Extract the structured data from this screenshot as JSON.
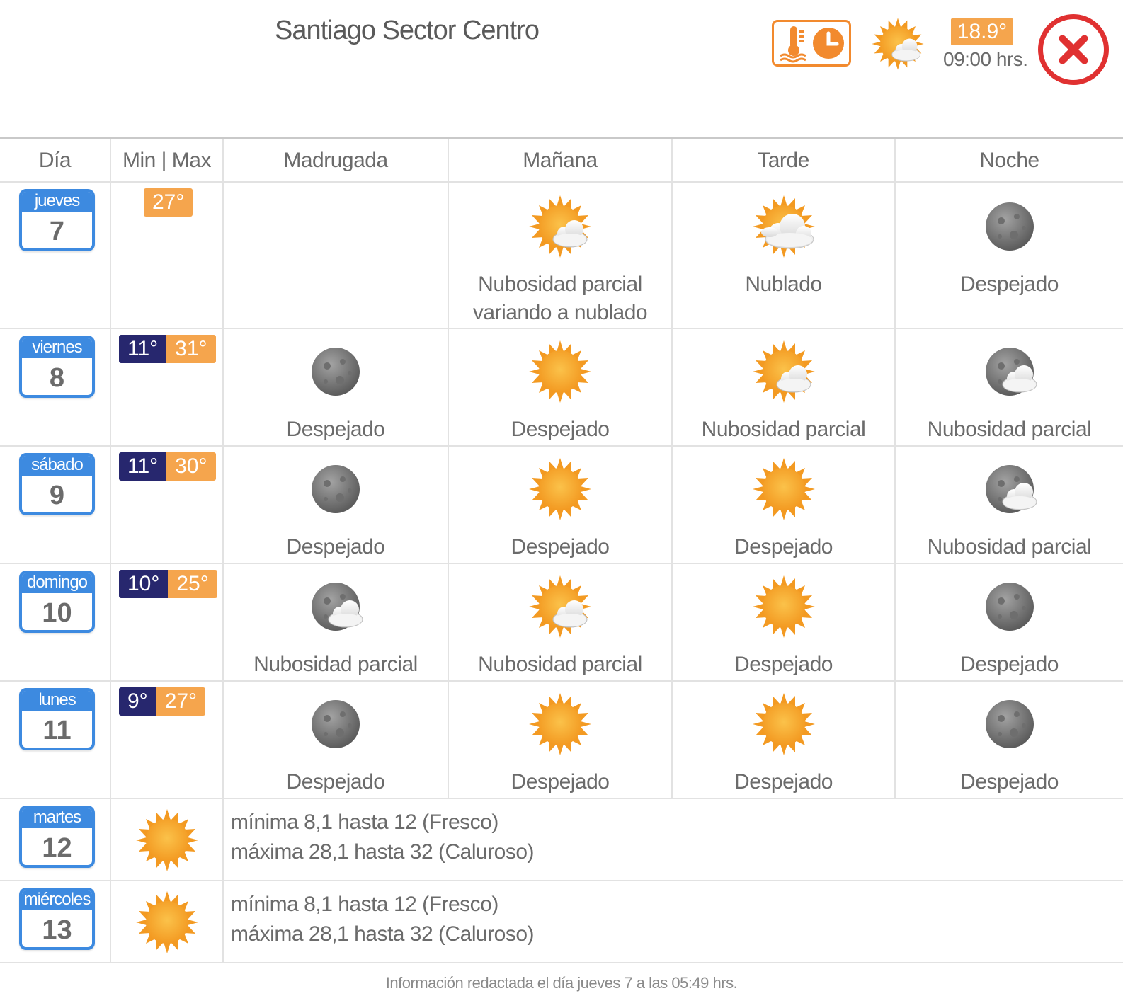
{
  "header": {
    "title": "Santiago Sector Centro",
    "history_icon": "thermometer-clock-icon",
    "current_icon": "partly-cloudy-day-icon",
    "current_temp": "18.9°",
    "current_time": "09:00 hrs."
  },
  "columns": [
    "Día",
    "Min | Max",
    "Madrugada",
    "Mañana",
    "Tarde",
    "Noche"
  ],
  "colors": {
    "accent_blue": "#3d8ae0",
    "min_bg": "#27276e",
    "max_bg": "#f5a54d",
    "close_red": "#e03131"
  },
  "days": [
    {
      "name": "jueves",
      "num": "7",
      "min": "",
      "max": "27°",
      "periods": [
        null,
        {
          "icon": "partly-cloudy-day",
          "label": "Nubosidad parcial variando a nublado"
        },
        {
          "icon": "cloudy-day",
          "label": "Nublado"
        },
        {
          "icon": "moon",
          "label": "Despejado"
        }
      ]
    },
    {
      "name": "viernes",
      "num": "8",
      "min": "11°",
      "max": "31°",
      "periods": [
        {
          "icon": "moon",
          "label": "Despejado"
        },
        {
          "icon": "sun",
          "label": "Despejado"
        },
        {
          "icon": "partly-cloudy-day",
          "label": "Nubosidad parcial"
        },
        {
          "icon": "partly-cloudy-night",
          "label": "Nubosidad parcial"
        }
      ]
    },
    {
      "name": "sábado",
      "num": "9",
      "min": "11°",
      "max": "30°",
      "periods": [
        {
          "icon": "moon",
          "label": "Despejado"
        },
        {
          "icon": "sun",
          "label": "Despejado"
        },
        {
          "icon": "sun",
          "label": "Despejado"
        },
        {
          "icon": "partly-cloudy-night",
          "label": "Nubosidad parcial"
        }
      ]
    },
    {
      "name": "domingo",
      "num": "10",
      "min": "10°",
      "max": "25°",
      "periods": [
        {
          "icon": "partly-cloudy-night",
          "label": "Nubosidad parcial"
        },
        {
          "icon": "partly-cloudy-day",
          "label": "Nubosidad parcial"
        },
        {
          "icon": "sun",
          "label": "Despejado"
        },
        {
          "icon": "moon",
          "label": "Despejado"
        }
      ]
    },
    {
      "name": "lunes",
      "num": "11",
      "min": "9°",
      "max": "27°",
      "periods": [
        {
          "icon": "moon",
          "label": "Despejado"
        },
        {
          "icon": "sun",
          "label": "Despejado"
        },
        {
          "icon": "sun",
          "label": "Despejado"
        },
        {
          "icon": "moon",
          "label": "Despejado"
        }
      ]
    }
  ],
  "extended": [
    {
      "name": "martes",
      "num": "12",
      "icon": "sun",
      "line1": "mínima 8,1 hasta 12 (Fresco)",
      "line2": "máxima 28,1 hasta 32 (Caluroso)"
    },
    {
      "name": "miércoles",
      "num": "13",
      "icon": "sun",
      "line1": "mínima 8,1 hasta 12 (Fresco)",
      "line2": "máxima 28,1 hasta 32 (Caluroso)"
    }
  ],
  "footer": "Información redactada el día jueves 7 a las 05:49 hrs."
}
